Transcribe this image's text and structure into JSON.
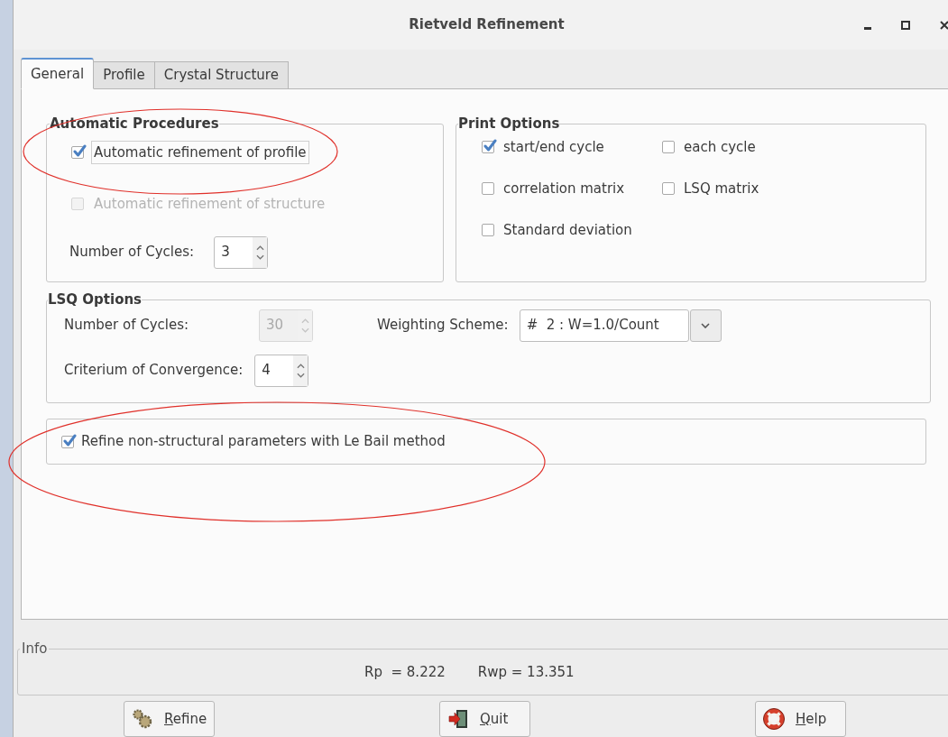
{
  "window": {
    "title": "Rietveld Refinement"
  },
  "tabs": [
    {
      "label": "General",
      "selected": true
    },
    {
      "label": "Profile",
      "selected": false
    },
    {
      "label": "Crystal Structure",
      "selected": false
    }
  ],
  "automatic_procedures": {
    "title": "Automatic Procedures",
    "options": [
      {
        "label": "Automatic refinement of profile",
        "checked": true,
        "disabled": false,
        "focused": true
      },
      {
        "label": "Automatic refinement of structure",
        "checked": false,
        "disabled": true,
        "focused": false
      }
    ],
    "cycles": {
      "label": "Number of Cycles:",
      "value": "3",
      "disabled": false
    }
  },
  "print_options": {
    "title": "Print Options",
    "options": [
      {
        "label": "start/end cycle",
        "checked": true
      },
      {
        "label": "each cycle",
        "checked": false
      },
      {
        "label": "correlation matrix",
        "checked": false
      },
      {
        "label": "LSQ matrix",
        "checked": false
      },
      {
        "label": "Standard deviation",
        "checked": false
      }
    ]
  },
  "lsq_options": {
    "title": "LSQ Options",
    "cycles": {
      "label": "Number of Cycles:",
      "value": "30",
      "disabled": true
    },
    "weighting": {
      "label": "Weighting Scheme:",
      "value": "#  2 : W=1.0/Count"
    },
    "convergence": {
      "label": "Criterium of Convergence:",
      "value": "4",
      "disabled": false
    }
  },
  "le_bail": {
    "label": "Refine non-structural parameters with Le Bail method",
    "checked": true
  },
  "info": {
    "title": "Info",
    "rp": "Rp  = 8.222",
    "rwp": "Rwp = 13.351"
  },
  "buttons": [
    {
      "label": "Refine",
      "kind": "gears",
      "mnemonic": true
    },
    {
      "label": "Quit",
      "kind": "exit",
      "mnemonic": true
    },
    {
      "label": "Help",
      "kind": "lifebuoy",
      "mnemonic": true
    }
  ]
}
